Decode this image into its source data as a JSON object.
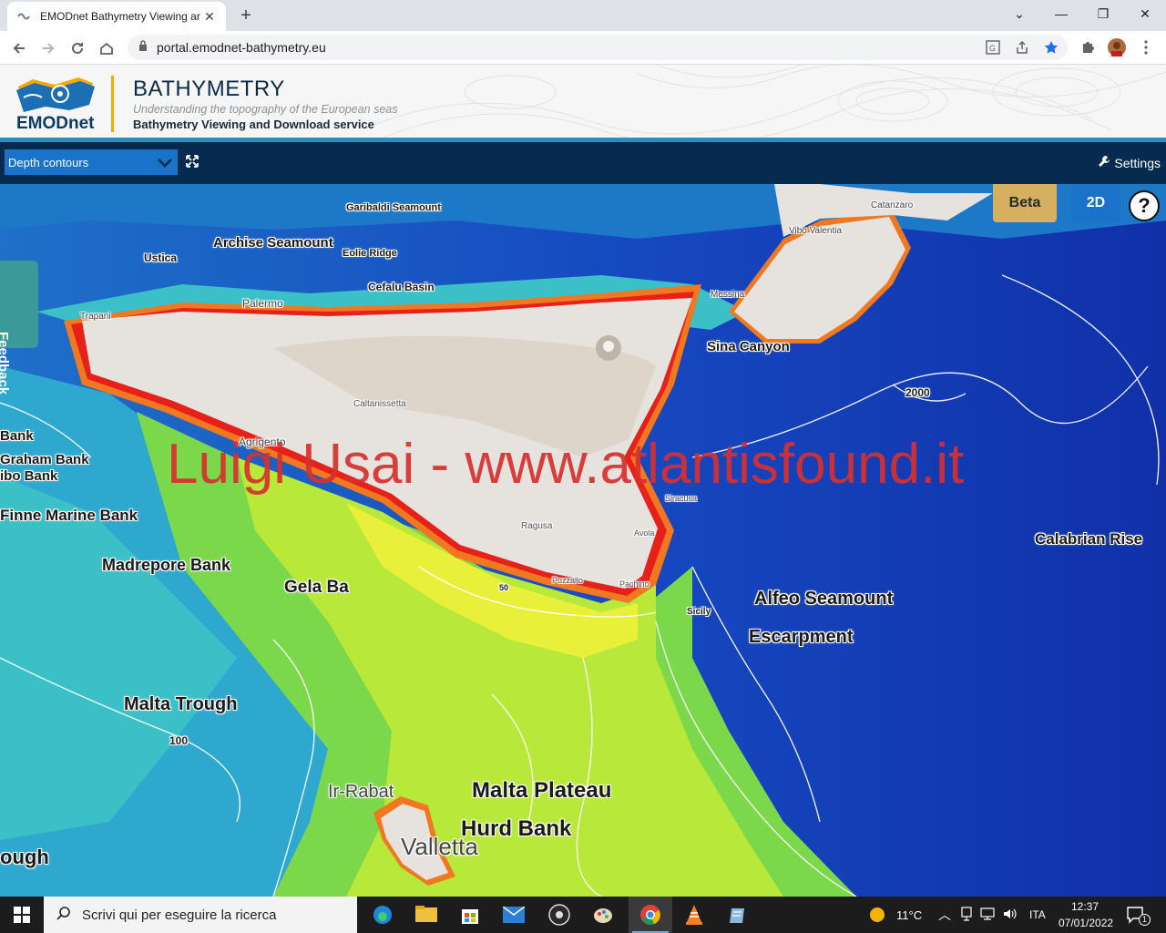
{
  "browser": {
    "tab_title": "EMODnet Bathymetry Viewing ar",
    "url": "portal.emodnet-bathymetry.eu"
  },
  "header": {
    "logo_text": "EMODnet",
    "title": "BATHYMETRY",
    "subtitle": "Understanding the topography of the European seas",
    "service": "Bathymetry Viewing and Download service"
  },
  "toolbar": {
    "layer_select_value": "Depth contours",
    "settings_label": "Settings"
  },
  "map": {
    "beta_label": "Beta",
    "view_mode_label": "2D",
    "help_label": "?",
    "feedback_label": "Feedback",
    "watermark": "Luigi Usai - www.atlantisfound.it",
    "labels": {
      "calabrian_rise": "Calabrian Rise",
      "alfeo_seamount": "Alfeo Seamount",
      "escarpment": "Escarpment",
      "sicily": "Sicily",
      "malta_plateau": "Malta Plateau",
      "hurd_bank": "Hurd Bank",
      "valletta": "Valletta",
      "ir_rabat": "Ir-Rabat",
      "malta_trough": "Malta Trough",
      "gela_basin": "Gela Ba",
      "madrepore_bank": "Madrepore Bank",
      "finne_marine_bank": "Finne Marine Bank",
      "graham_bank": "Graham Bank",
      "bank": "Bank",
      "ibo_bank": "ibo Bank",
      "ough": "ough",
      "sina_canyon": "Sina Canyon",
      "cefalu_basin": "Cefalu Basin",
      "aeolian": "Archise Seamount",
      "ustica": "Ustica",
      "palermo": "Palermo",
      "trapani": "Trapani",
      "agrigento": "Agrigento",
      "caltanissetta": "Caltanissetta",
      "ragusa": "Ragusa",
      "pozzallo": "Pozzallo",
      "pachino": "Pachino",
      "messina": "Messina",
      "contour_2000": "2000",
      "contour_100": "100",
      "contour_50": "50",
      "garibaldi": "Garibaldi Seamount",
      "eolie_ridge": "Eolie Ridge",
      "vibo_valentia": "Vibo Valentia",
      "catanzaro": "Catanzaro",
      "siracusa": "Siracusa",
      "augusta": "Avola"
    }
  },
  "taskbar": {
    "search_placeholder": "Scrivi qui per eseguire la ricerca",
    "temperature": "11°C",
    "language": "ITA",
    "time": "12:37",
    "date": "07/01/2022",
    "notifications": "1"
  }
}
